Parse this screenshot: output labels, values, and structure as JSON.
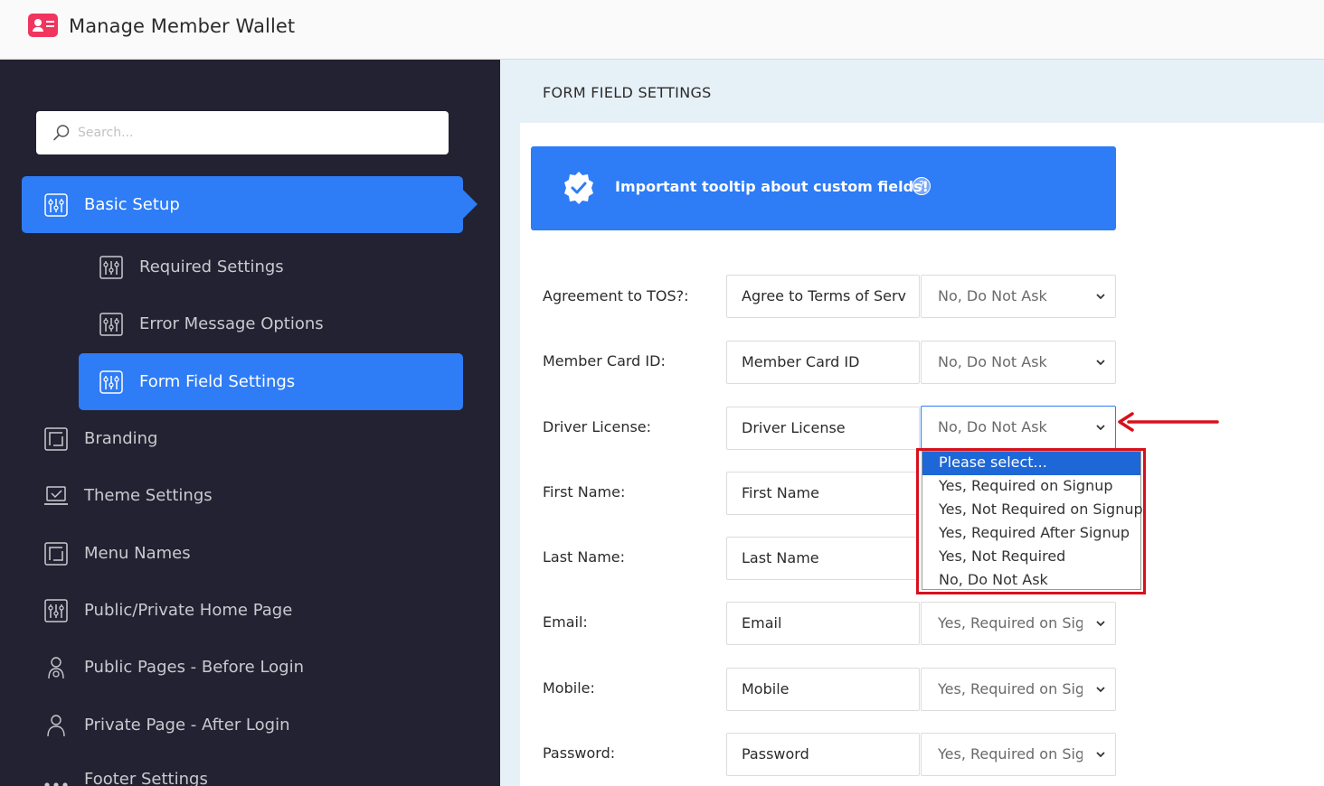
{
  "header": {
    "title": "Manage Member Wallet",
    "logo_icon": "member-card-icon"
  },
  "sidebar": {
    "search_placeholder": "Search...",
    "items": [
      {
        "label": "Basic Setup",
        "icon": "sliders-icon"
      },
      {
        "label": "Required Settings",
        "icon": "sliders-icon"
      },
      {
        "label": "Error Message Options",
        "icon": "sliders-icon"
      },
      {
        "label": "Form Field Settings",
        "icon": "sliders-icon"
      },
      {
        "label": "Branding",
        "icon": "frame-icon"
      },
      {
        "label": "Theme Settings",
        "icon": "laptop-check-icon"
      },
      {
        "label": "Menu Names",
        "icon": "frame-icon"
      },
      {
        "label": "Public/Private Home Page",
        "icon": "sliders-icon"
      },
      {
        "label": "Public Pages - Before Login",
        "icon": "user-gear-icon"
      },
      {
        "label": "Private Page - After Login",
        "icon": "user-icon"
      },
      {
        "label": "Footer Settings",
        "icon": "dots-icon"
      }
    ],
    "accent_color": "#2e7cf6",
    "background_color": "#232232"
  },
  "content": {
    "title": "FORM FIELD SETTINGS",
    "tooltip": {
      "text": "Important tooltip about custom fields!",
      "help_icon": "?"
    },
    "rows": [
      {
        "label": "Agreement to TOS?:",
        "field_value": "Agree to Terms of Serv",
        "select_value": "No, Do Not Ask"
      },
      {
        "label": "Member Card ID:",
        "field_value": "Member Card ID",
        "select_value": "No, Do Not Ask"
      },
      {
        "label": "Driver License:",
        "field_value": "Driver License",
        "select_value": "No, Do Not Ask"
      },
      {
        "label": "First Name:",
        "field_value": "First Name",
        "select_value": ""
      },
      {
        "label": "Last Name:",
        "field_value": "Last Name",
        "select_value": ""
      },
      {
        "label": "Email:",
        "field_value": "Email",
        "select_value": "Yes, Required on Signup"
      },
      {
        "label": "Mobile:",
        "field_value": "Mobile",
        "select_value": "Yes, Required on Signup"
      },
      {
        "label": "Password:",
        "field_value": "Password",
        "select_value": "Yes, Required on Signup"
      }
    ],
    "dropdown_options": [
      "Please select...",
      "Yes, Required on Signup",
      "Yes, Not Required on Signup",
      "Yes, Required After Signup",
      "Yes, Not Required",
      "No, Do Not Ask"
    ],
    "highlight_color": "#d8101c"
  }
}
